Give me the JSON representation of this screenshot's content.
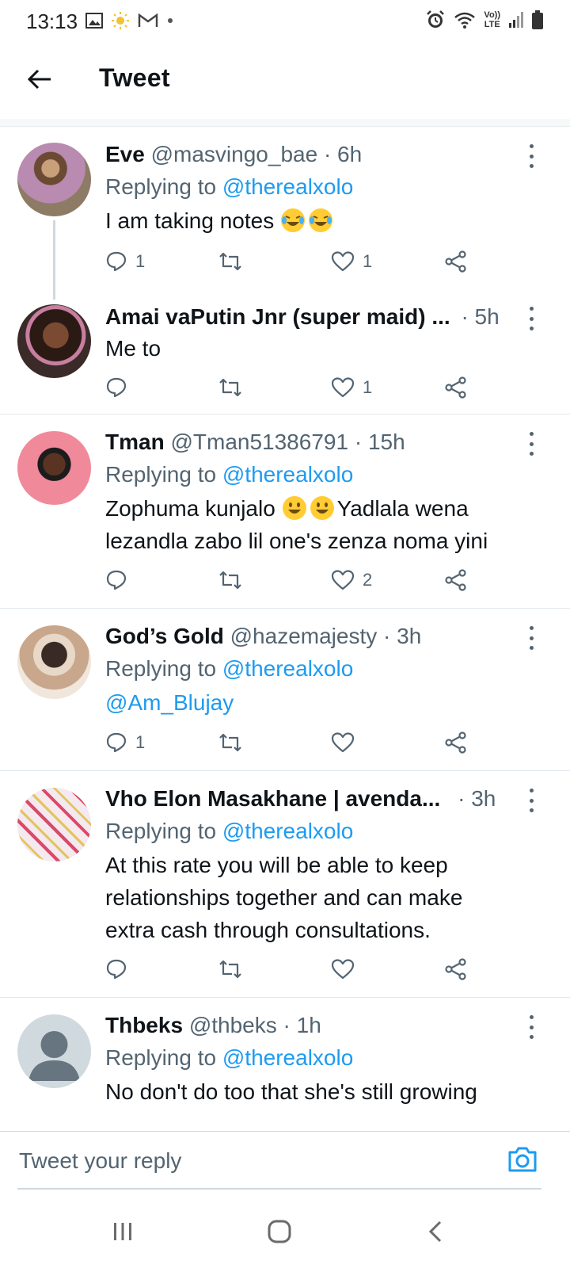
{
  "status_bar": {
    "time": "13:13",
    "left_icons": [
      "gallery-icon",
      "weather-sun-icon",
      "gmail-icon",
      "notification-dot-icon"
    ],
    "right_icons": [
      "alarm-icon",
      "wifi-icon",
      "volte-icon",
      "signal-icon",
      "battery-icon"
    ],
    "volte_label_top": "Vo))",
    "volte_label_bottom": "LTE"
  },
  "app_bar": {
    "title": "Tweet"
  },
  "tweets": [
    {
      "name": "Eve",
      "handle": "@masvingo_bae",
      "time": "6h",
      "replying_prefix": "Replying to ",
      "replying_to": "@therealxolo",
      "text": "I am taking notes",
      "emoji": [
        "rolling-on-floor-laughing",
        "rolling-on-floor-laughing"
      ],
      "replies": "1",
      "retweets": "",
      "likes": "1"
    },
    {
      "name": "Amai vaPutin Jnr (super maid) ...",
      "handle": "",
      "time": "5h",
      "text": "Me to",
      "replies": "",
      "retweets": "",
      "likes": "1"
    },
    {
      "name": "Tman",
      "handle": "@Tman51386791",
      "time": "15h",
      "replying_prefix": "Replying to ",
      "replying_to": "@therealxolo",
      "text_line1_a": "Zophuma kunjalo",
      "text_line1_b": "Yadlala wena",
      "text_line2": "lezandla zabo lil one's zenza noma yini",
      "emoji": [
        "grinning-face",
        "grinning-face"
      ],
      "replies": "",
      "retweets": "",
      "likes": "2"
    },
    {
      "name": "God’s Gold",
      "handle": "@hazemajesty",
      "time": "3h",
      "replying_prefix": "Replying to ",
      "replying_to": "@therealxolo",
      "text": "@Am_Blujay",
      "replies": "1",
      "retweets": "",
      "likes": ""
    },
    {
      "name": "Vho Elon Masakhane | avenda...",
      "handle": "",
      "time": "3h",
      "replying_prefix": "Replying to ",
      "replying_to": "@therealxolo",
      "text_line1": "At this rate you will be able to keep",
      "text_line2": "relationships together and can make",
      "text_line3": "extra cash through consultations.",
      "replies": "",
      "retweets": "",
      "likes": ""
    },
    {
      "name": "Thbeks",
      "handle": "@thbeks",
      "time": "1h",
      "replying_prefix": "Replying to ",
      "replying_to": "@therealxolo",
      "text": "No don't do too that she's still growing"
    }
  ],
  "separator_dot": "·",
  "reply_bar": {
    "placeholder": "Tweet your reply",
    "camera_icon": "camera-icon"
  },
  "nav_bar": {
    "icons": [
      "recent-apps-icon",
      "home-icon",
      "back-icon"
    ]
  },
  "colors": {
    "link": "#1d9bf0",
    "secondary_text": "#536471",
    "primary_text": "#0f1419",
    "divider": "#e1e8ed"
  }
}
